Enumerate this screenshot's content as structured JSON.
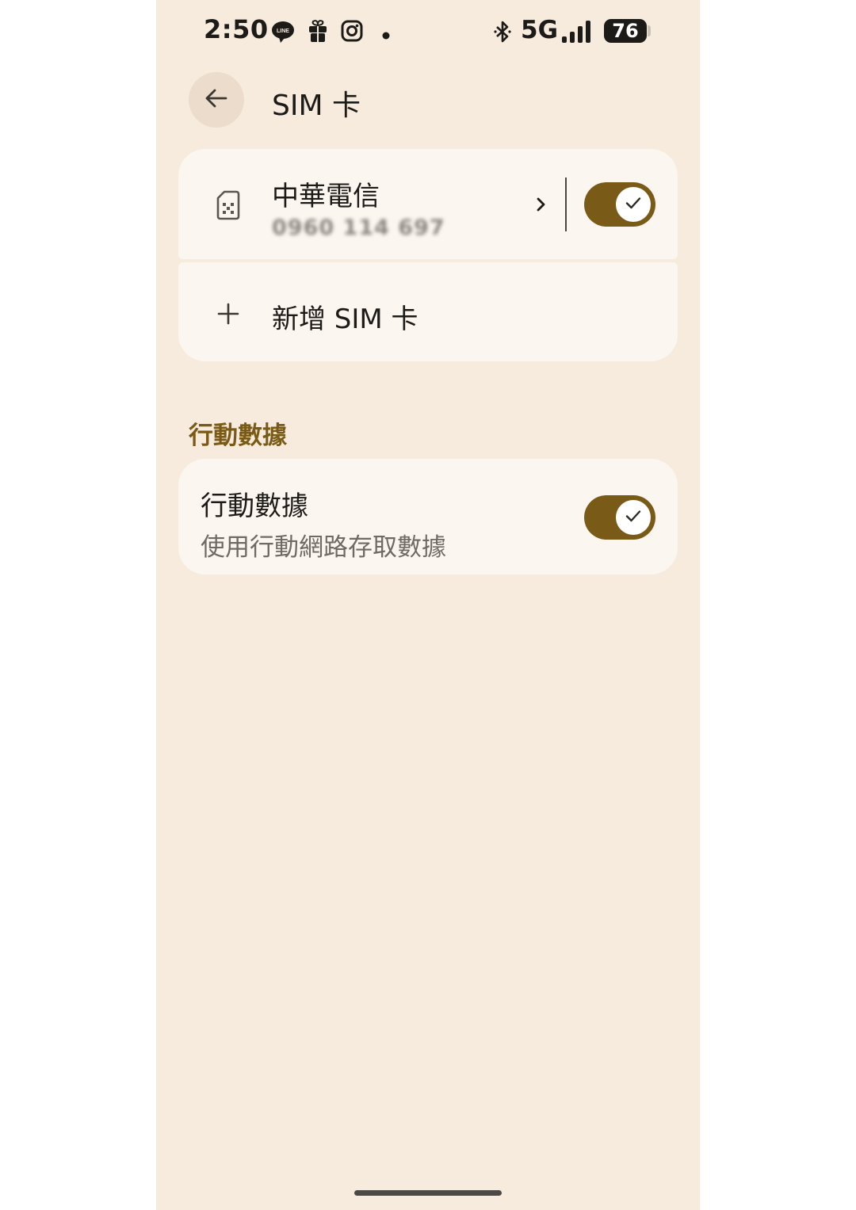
{
  "status_bar": {
    "time": "2:50",
    "left_icons": [
      "line-app-icon",
      "gift-icon",
      "instagram-icon",
      "dot-icon"
    ],
    "right_icons": [
      "bluetooth-icon",
      "signal-icon"
    ],
    "network": "5G",
    "battery": "76"
  },
  "header": {
    "title": "SIM 卡",
    "back_icon": "arrow-left-icon"
  },
  "sim_card": {
    "carrier": "中華電信",
    "number": "0960 114 697",
    "enabled": true,
    "icon": "sim-card-icon"
  },
  "add_sim": {
    "label": "新增 SIM 卡",
    "icon": "plus-icon"
  },
  "mobile_data_section": {
    "title": "行動數據",
    "item": {
      "title": "行動數據",
      "subtitle": "使用行動網路存取數據",
      "enabled": true
    }
  },
  "colors": {
    "background": "#f7ebdd",
    "card": "#fcf6f0",
    "accent": "#7a5a17",
    "text": "#1d1b18"
  }
}
